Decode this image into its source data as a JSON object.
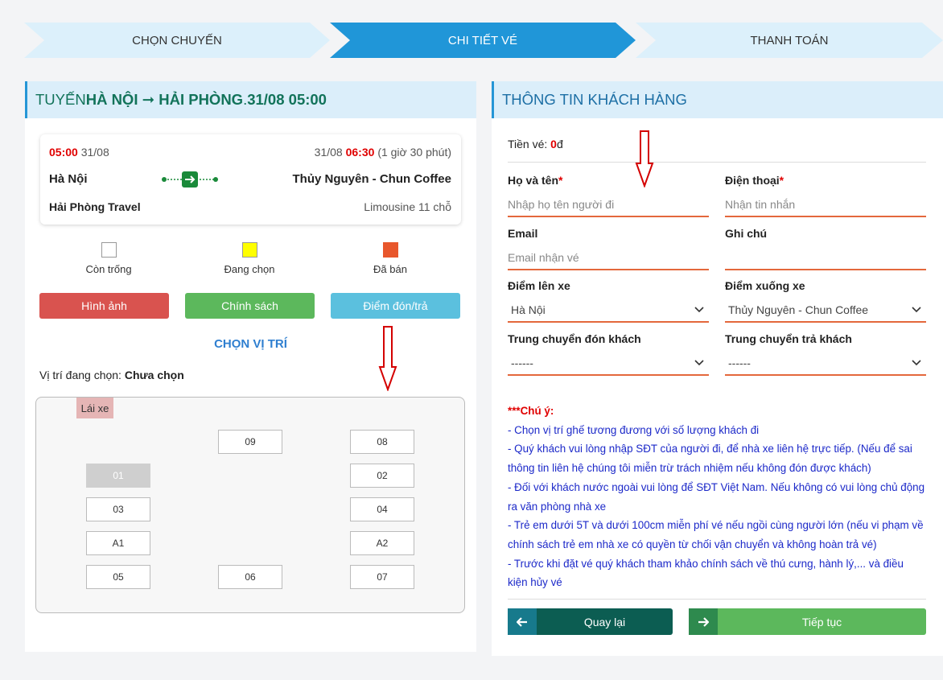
{
  "steps": [
    {
      "label": "CHỌN CHUYẾN"
    },
    {
      "label": "CHI TIẾT VÉ"
    },
    {
      "label": "THANH TOÁN"
    }
  ],
  "colors": {
    "step_active": "#2096d8",
    "step_inactive": "#dcf0fb",
    "accent_red": "#e00000",
    "input_underline": "#e4683c"
  },
  "left": {
    "header_prefix": "TUYẾN ",
    "header_route": "HÀ NỘI ➞ HẢI PHÒNG",
    "header_dot": ". ",
    "header_datetime": "31/08 05:00",
    "trip": {
      "depart_time": "05:00",
      "depart_date": "31/08",
      "arrive_date": "31/08",
      "arrive_time": "06:30",
      "duration": "(1 giờ 30 phút)",
      "origin": "Hà Nội",
      "destination": "Thủy Nguyên - Chun Coffee",
      "operator": "Hải Phòng Travel",
      "vehicle": "Limousine 11 chỗ"
    },
    "legend": [
      {
        "label": "Còn trống",
        "color": "#ffffff"
      },
      {
        "label": "Đang chọn",
        "color": "#ffff00"
      },
      {
        "label": "Đã bán",
        "color": "#e8572c"
      }
    ],
    "buttons": {
      "images": "Hình ảnh",
      "policy": "Chính sách",
      "pickup": "Điểm đón/trả"
    },
    "choose_position": "CHỌN VỊ TRÍ",
    "current_position_label": "Vị trí đang chọn: ",
    "current_position_value": "Chưa chọn",
    "driver": "Lái xe",
    "seats": {
      "s09": "09",
      "s08": "08",
      "s01": "01",
      "s02": "02",
      "s03": "03",
      "s04": "04",
      "sA1": "A1",
      "sA2": "A2",
      "s05": "05",
      "s06": "06",
      "s07": "07"
    }
  },
  "right": {
    "header": "THÔNG TIN KHÁCH HÀNG",
    "price_label": "Tiền vé: ",
    "price_value": "0",
    "price_unit": "đ",
    "fields": {
      "name_label": "Họ và tên",
      "name_placeholder": "Nhập họ tên người đi",
      "phone_label": "Điện thoại",
      "phone_placeholder": "Nhận tin nhắn",
      "email_label": "Email",
      "email_placeholder": "Email nhận vé",
      "note_label": "Ghi chú",
      "note_placeholder": "",
      "board_label": "Điểm lên xe",
      "board_value": "Hà Nội",
      "alight_label": "Điểm xuống xe",
      "alight_value": "Thủy Nguyên - Chun Coffee",
      "pickup_transfer_label": "Trung chuyển đón khách",
      "pickup_transfer_value": "------",
      "drop_transfer_label": "Trung chuyển trả khách",
      "drop_transfer_value": "------",
      "required_mark": "*"
    },
    "notes": {
      "title": "***Chú ý:",
      "items": [
        "- Chọn vị trí ghế tương đương với số lượng khách đi",
        "- Quý khách vui lòng nhập SĐT của người đi, để nhà xe liên hệ trực tiếp. (Nếu để sai thông tin liên hệ chúng tôi miễn trừ trách nhiệm nếu không đón được khách)",
        "- Đối với khách nước ngoài vui lòng để SĐT Việt Nam. Nếu không có vui lòng chủ động ra văn phòng nhà xe",
        "- Trẻ em dưới 5T và dưới 100cm miễn phí vé nếu ngồi cùng người lớn (nếu vi phạm về chính sách trẻ em nhà xe có quyền từ chối vận chuyển và không hoàn trả vé)",
        "- Trước khi đặt vé quý khách tham khảo chính sách về thú cưng, hành lý,... và điều kiện hủy vé"
      ]
    },
    "back_button": "Quay lại",
    "next_button": "Tiếp tục"
  }
}
